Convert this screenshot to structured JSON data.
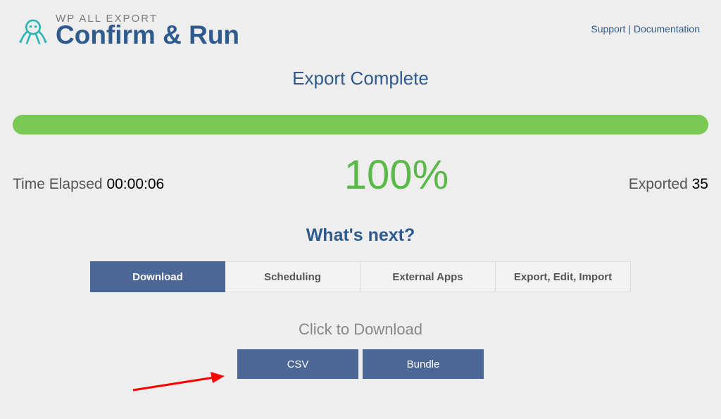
{
  "header": {
    "app_name": "WP ALL EXPORT",
    "page_title": "Confirm & Run",
    "links": {
      "support": "Support",
      "sep": " | ",
      "documentation": "Documentation"
    }
  },
  "status": {
    "title": "Export Complete",
    "time_label": "Time Elapsed ",
    "time_value": "00:00:06",
    "percent": "100%",
    "exported_label": "Exported ",
    "exported_value": "35"
  },
  "next": {
    "heading": "What's next?",
    "tabs": [
      "Download",
      "Scheduling",
      "External Apps",
      "Export, Edit, Import"
    ],
    "subheading": "Click to Download",
    "buttons": [
      "CSV",
      "Bundle"
    ]
  }
}
